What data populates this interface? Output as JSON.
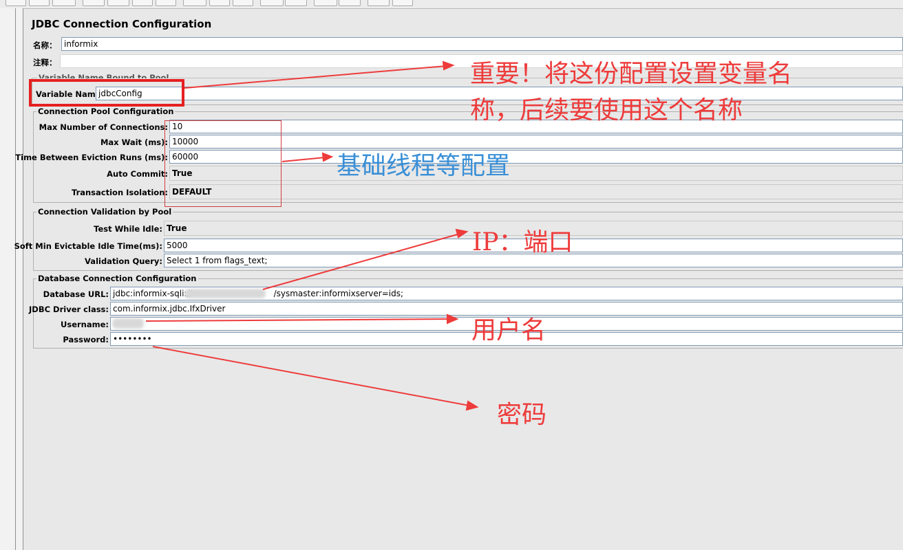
{
  "panel": {
    "title": "JDBC Connection Configuration"
  },
  "general": {
    "name_label": "名称：",
    "name_value": "informix",
    "comment_label": "注释："
  },
  "variable_group": {
    "legend": "Variable Name Bound to Pool",
    "variable_name_label": "Variable Name:",
    "variable_name_value": "jdbcConfig"
  },
  "pool_group": {
    "legend": "Connection Pool Configuration",
    "max_connections_label": "Max Number of Connections:",
    "max_connections_value": "10",
    "max_wait_label": "Max Wait (ms):",
    "max_wait_value": "10000",
    "eviction_label": "Time Between Eviction Runs (ms):",
    "eviction_value": "60000",
    "auto_commit_label": "Auto Commit:",
    "auto_commit_value": "True",
    "isolation_label": "Transaction Isolation:",
    "isolation_value": "DEFAULT"
  },
  "validation_group": {
    "legend": "Connection Validation by Pool",
    "test_idle_label": "Test While Idle:",
    "test_idle_value": "True",
    "soft_min_label": "Soft Min Evictable Idle Time(ms):",
    "soft_min_value": "5000",
    "query_label": "Validation Query:",
    "query_value": "Select 1 from flags_text;"
  },
  "db_group": {
    "legend": "Database Connection Configuration",
    "url_label": "Database URL:",
    "url_prefix": "jdbc:informix-sqli://",
    "url_suffix": "/sysmaster:informixserver=ids;",
    "driver_label": "JDBC Driver class:",
    "driver_value": "com.informix.jdbc.IfxDriver",
    "username_label": "Username:",
    "password_label": "Password:",
    "password_value": "••••••••"
  },
  "annotations": {
    "variable_note_line1": "重要！将这份配置设置变量名",
    "variable_note_line2": "称，后续要使用这个名称",
    "pool_note": "基础线程等配置",
    "ip_note": "IP：端口",
    "username_note": "用户名",
    "password_note": "密码"
  },
  "colors": {
    "annotation_red": "#ee3b3b",
    "annotation_blue": "#3a8fd6",
    "field_border": "#7e99b3"
  }
}
